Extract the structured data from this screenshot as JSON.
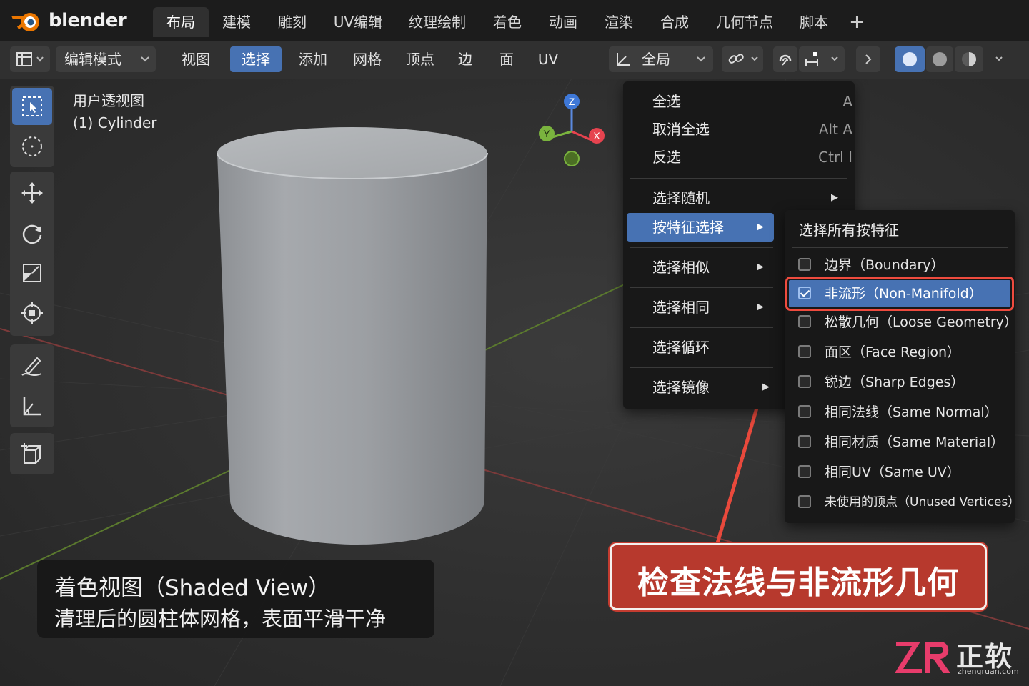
{
  "app": {
    "logo_text": "blender"
  },
  "workspaces": [
    "布局",
    "建模",
    "雕刻",
    "UV编辑",
    "纹理绘制",
    "着色",
    "动画",
    "渲染",
    "合成",
    "几何节点",
    "脚本"
  ],
  "workspace_add": "+",
  "header": {
    "mode": "编辑模式",
    "menus": [
      "视图",
      "选择",
      "添加",
      "网格",
      "顶点",
      "边",
      "面",
      "UV"
    ],
    "orientation": "全局"
  },
  "viewport_info": {
    "view_name": "用户透视图",
    "object": "(1) Cylinder"
  },
  "gizmo": {
    "z": "Z",
    "y": "Y",
    "x": "X"
  },
  "select_menu": {
    "items": [
      {
        "label": "全选",
        "shortcut": "A",
        "arrow": ""
      },
      {
        "label": "取消全选",
        "shortcut": "Alt A",
        "arrow": ""
      },
      {
        "label": "反选",
        "shortcut": "Ctrl I",
        "arrow": ""
      },
      {
        "label": "选择随机",
        "shortcut": "",
        "arrow": "▶"
      },
      {
        "label": "按特征选择",
        "shortcut": "",
        "arrow": "▶"
      },
      {
        "label": "选择相似",
        "shortcut": "",
        "arrow": "▶"
      },
      {
        "label": "选择相同",
        "shortcut": "",
        "arrow": "▶"
      },
      {
        "label": "选择循环",
        "shortcut": "",
        "arrow": ""
      },
      {
        "label": "选择镜像",
        "shortcut": "",
        "arrow": "▶"
      }
    ]
  },
  "submenu": {
    "title": "选择所有按特征",
    "options": [
      {
        "label": "边界（Boundary）",
        "checked": false
      },
      {
        "label": "非流形（Non-Manifold）",
        "checked": true
      },
      {
        "label": "松散几何（Loose Geometry）",
        "checked": false
      },
      {
        "label": "面区（Face Region）",
        "checked": false
      },
      {
        "label": "锐边（Sharp Edges）",
        "checked": false
      },
      {
        "label": "相同法线（Same Normal）",
        "checked": false
      },
      {
        "label": "相同材质（Same Material）",
        "checked": false
      },
      {
        "label": "相同UV（Same UV）",
        "checked": false
      },
      {
        "label": "未使用的顶点（Unused Vertices）",
        "checked": false
      }
    ]
  },
  "caption": {
    "line1": "着色视图（Shaded View）",
    "line2": "清理后的圆柱体网格，表面平滑干净"
  },
  "banner": "检查法线与非流形几何",
  "watermark": {
    "brand": "正软",
    "url": "zhengruan.com"
  },
  "colors": {
    "accent": "#4772b3",
    "highlight_red": "#ee4b3e",
    "banner_bg": "#b7392d",
    "logo_orange": "#ea7600"
  }
}
